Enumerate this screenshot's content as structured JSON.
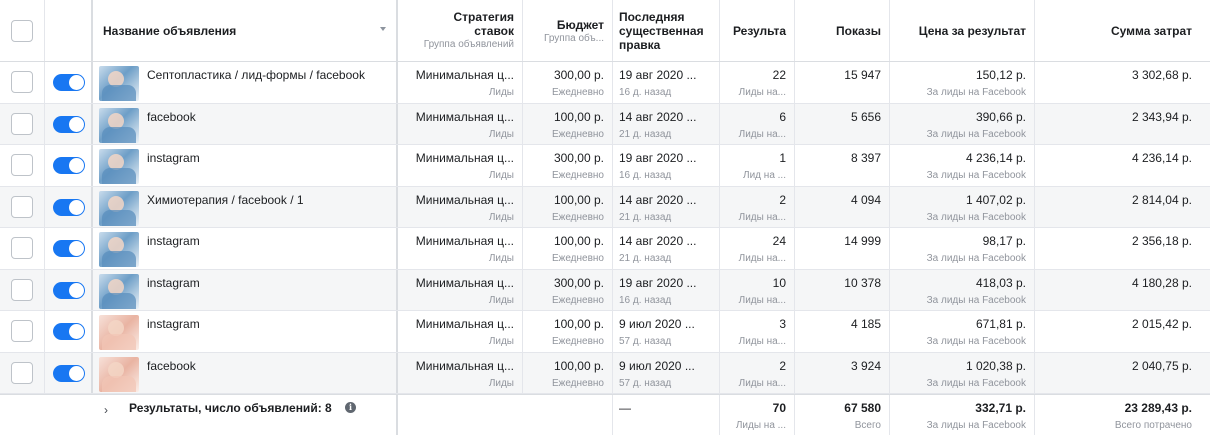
{
  "header": {
    "name": "Название объявления",
    "strategy_line1": "Стратегия",
    "strategy_line2": "ставок",
    "strategy_sub": "Группа объявлений",
    "budget": "Бюджет",
    "budget_sub": "Группа объ...",
    "last_edit_line1": "Последняя",
    "last_edit_line2": "существенная",
    "last_edit_line3": "правка",
    "results": "Результа",
    "impressions": "Показы",
    "cost_per_result": "Цена за результат",
    "amount_spent": "Сумма затрат"
  },
  "rows": [
    {
      "name": "Септопластика / лид-формы / facebook",
      "thumb": "blue",
      "strategy": "Минимальная ц...",
      "strategy_sub": "Лиды",
      "budget": "300,00 р.",
      "budget_sub": "Ежедневно",
      "edit_date": "19 авг 2020 ...",
      "edit_ago": "16 д. назад",
      "results": "22",
      "results_sub": "Лиды на...",
      "impressions": "15 947",
      "cpr": "150,12 р.",
      "cpr_sub": "За лиды на Facebook",
      "spent": "3 302,68 р."
    },
    {
      "name": "facebook",
      "thumb": "blue",
      "strategy": "Минимальная ц...",
      "strategy_sub": "Лиды",
      "budget": "100,00 р.",
      "budget_sub": "Ежедневно",
      "edit_date": "14 авг 2020 ...",
      "edit_ago": "21 д. назад",
      "results": "6",
      "results_sub": "Лиды на...",
      "impressions": "5 656",
      "cpr": "390,66 р.",
      "cpr_sub": "За лиды на Facebook",
      "spent": "2 343,94 р."
    },
    {
      "name": "instagram",
      "thumb": "blue",
      "strategy": "Минимальная ц...",
      "strategy_sub": "Лиды",
      "budget": "300,00 р.",
      "budget_sub": "Ежедневно",
      "edit_date": "19 авг 2020 ...",
      "edit_ago": "16 д. назад",
      "results": "1",
      "results_sub": "Лид на ...",
      "impressions": "8 397",
      "cpr": "4 236,14 р.",
      "cpr_sub": "За лиды на Facebook",
      "spent": "4 236,14 р."
    },
    {
      "name": "Химиотерапия / facebook / 1",
      "thumb": "blue",
      "strategy": "Минимальная ц...",
      "strategy_sub": "Лиды",
      "budget": "100,00 р.",
      "budget_sub": "Ежедневно",
      "edit_date": "14 авг 2020 ...",
      "edit_ago": "21 д. назад",
      "results": "2",
      "results_sub": "Лиды на...",
      "impressions": "4 094",
      "cpr": "1 407,02 р.",
      "cpr_sub": "За лиды на Facebook",
      "spent": "2 814,04 р."
    },
    {
      "name": "instagram",
      "thumb": "blue",
      "strategy": "Минимальная ц...",
      "strategy_sub": "Лиды",
      "budget": "100,00 р.",
      "budget_sub": "Ежедневно",
      "edit_date": "14 авг 2020 ...",
      "edit_ago": "21 д. назад",
      "results": "24",
      "results_sub": "Лиды на...",
      "impressions": "14 999",
      "cpr": "98,17 р.",
      "cpr_sub": "За лиды на Facebook",
      "spent": "2 356,18 р."
    },
    {
      "name": "instagram",
      "thumb": "blue",
      "strategy": "Минимальная ц...",
      "strategy_sub": "Лиды",
      "budget": "300,00 р.",
      "budget_sub": "Ежедневно",
      "edit_date": "19 авг 2020 ...",
      "edit_ago": "16 д. назад",
      "results": "10",
      "results_sub": "Лиды на...",
      "impressions": "10 378",
      "cpr": "418,03 р.",
      "cpr_sub": "За лиды на Facebook",
      "spent": "4 180,28 р."
    },
    {
      "name": "instagram",
      "thumb": "pink",
      "strategy": "Минимальная ц...",
      "strategy_sub": "Лиды",
      "budget": "100,00 р.",
      "budget_sub": "Ежедневно",
      "edit_date": "9 июл 2020 ...",
      "edit_ago": "57 д. назад",
      "results": "3",
      "results_sub": "Лиды на...",
      "impressions": "4 185",
      "cpr": "671,81 р.",
      "cpr_sub": "За лиды на Facebook",
      "spent": "2 015,42 р."
    },
    {
      "name": "facebook",
      "thumb": "pink",
      "strategy": "Минимальная ц...",
      "strategy_sub": "Лиды",
      "budget": "100,00 р.",
      "budget_sub": "Ежедневно",
      "edit_date": "9 июл 2020 ...",
      "edit_ago": "57 д. назад",
      "results": "2",
      "results_sub": "Лиды на...",
      "impressions": "3 924",
      "cpr": "1 020,38 р.",
      "cpr_sub": "За лиды на Facebook",
      "spent": "2 040,75 р."
    }
  ],
  "footer": {
    "expand": "›",
    "label": "Результаты, число объявлений: 8",
    "info": "i",
    "last_edit": "—",
    "results": "70",
    "results_sub": "Лиды на ...",
    "impressions": "67 580",
    "impressions_sub": "Всего",
    "cpr": "332,71 р.",
    "cpr_sub": "За лиды на Facebook",
    "spent": "23 289,43 р.",
    "spent_sub": "Всего потрачено"
  },
  "colors": {
    "toggle_on": "#1877f2",
    "alt_row": "#f5f6f7",
    "muted_text": "#90949c"
  },
  "icons": {
    "sort": "sort-down-icon",
    "expand": "chevron-right-icon",
    "info": "info-icon"
  }
}
